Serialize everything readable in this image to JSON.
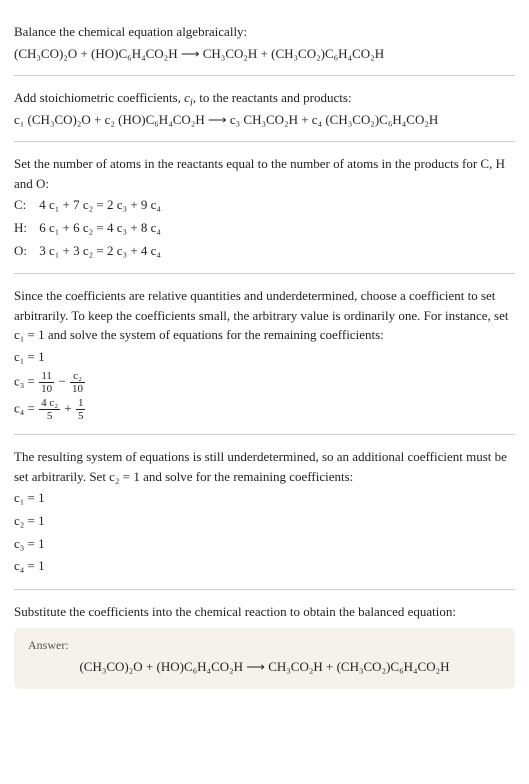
{
  "s1": {
    "title": "Balance the chemical equation algebraically:",
    "eq": "(CH₃CO)₂O + (HO)C₆H₄CO₂H  ⟶  CH₃CO₂H + (CH₃CO₂)C₆H₄CO₂H"
  },
  "s2": {
    "title_a": "Add stoichiometric coefficients, ",
    "title_ci": "c",
    "title_ci_sub": "i",
    "title_b": ", to the reactants and products:",
    "eq": "c₁ (CH₃CO)₂O + c₂ (HO)C₆H₄CO₂H  ⟶  c₃ CH₃CO₂H + c₄ (CH₃CO₂)C₆H₄CO₂H"
  },
  "s3": {
    "text": "Set the number of atoms in the reactants equal to the number of atoms in the products for C, H and O:",
    "rows": [
      {
        "elem": "C:",
        "eq": "4 c₁ + 7 c₂ = 2 c₃ + 9 c₄"
      },
      {
        "elem": "H:",
        "eq": "6 c₁ + 6 c₂ = 4 c₃ + 8 c₄"
      },
      {
        "elem": "O:",
        "eq": "3 c₁ + 3 c₂ = 2 c₃ + 4 c₄"
      }
    ]
  },
  "s4": {
    "text": "Since the coefficients are relative quantities and underdetermined, choose a coefficient to set arbitrarily. To keep the coefficients small, the arbitrary value is ordinarily one. For instance, set c₁ = 1 and solve the system of equations for the remaining coefficients:",
    "eq1": "c₁ = 1",
    "eq2_lhs": "c₃ = ",
    "eq2_f1_num": "11",
    "eq2_f1_den": "10",
    "eq2_minus": " − ",
    "eq2_f2_num": "c₂",
    "eq2_f2_den": "10",
    "eq3_lhs": "c₄ = ",
    "eq3_f1_num": "4 c₂",
    "eq3_f1_den": "5",
    "eq3_plus": " + ",
    "eq3_f2_num": "1",
    "eq3_f2_den": "5"
  },
  "s5": {
    "text": "The resulting system of equations is still underdetermined, so an additional coefficient must be set arbitrarily. Set c₂ = 1 and solve for the remaining coefficients:",
    "rows": [
      "c₁ = 1",
      "c₂ = 1",
      "c₃ = 1",
      "c₄ = 1"
    ]
  },
  "s6": {
    "text": "Substitute the coefficients into the chemical reaction to obtain the balanced equation:",
    "answer_label": "Answer:",
    "answer_eq": "(CH₃CO)₂O + (HO)C₆H₄CO₂H  ⟶  CH₃CO₂H + (CH₃CO₂)C₆H₄CO₂H"
  }
}
